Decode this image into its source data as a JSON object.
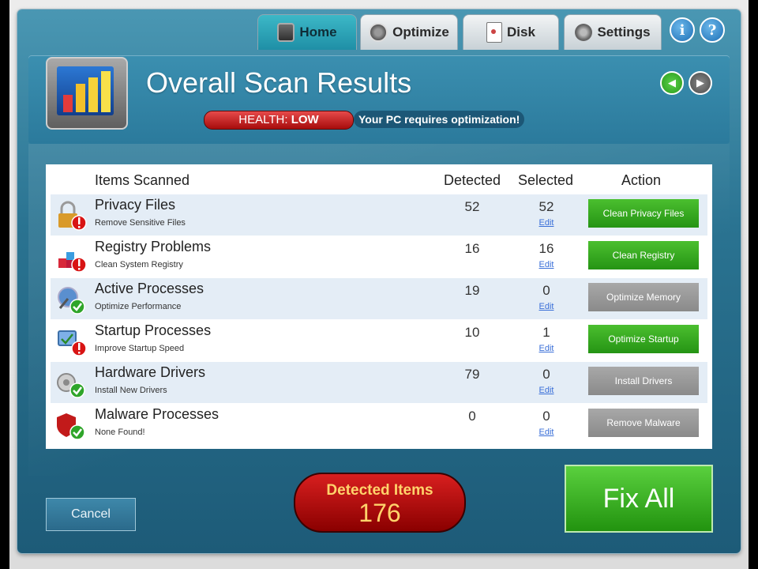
{
  "tabs": [
    {
      "label": "Home",
      "icon": "home-icon",
      "active": true
    },
    {
      "label": "Optimize",
      "icon": "optimize-icon",
      "active": false
    },
    {
      "label": "Disk",
      "icon": "disk-icon",
      "active": false
    },
    {
      "label": "Settings",
      "icon": "settings-icon",
      "active": false
    }
  ],
  "header": {
    "title": "Overall Scan Results",
    "health_prefix": "HEALTH:",
    "health_value": "LOW",
    "message": "Your PC requires optimization!"
  },
  "round_buttons": {
    "info": "i",
    "help": "?"
  },
  "table": {
    "columns": {
      "items": "Items Scanned",
      "detected": "Detected",
      "selected": "Selected",
      "action": "Action"
    },
    "rows": [
      {
        "title": "Privacy Files",
        "subtitle": "Remove Sensitive Files",
        "detected": "52",
        "selected": "52",
        "edit": "Edit",
        "action": "Clean Privacy Files",
        "action_enabled": true,
        "icon": "lock-warning-icon"
      },
      {
        "title": "Registry Problems",
        "subtitle": "Clean System Registry",
        "detected": "16",
        "selected": "16",
        "edit": "Edit",
        "action": "Clean Registry",
        "action_enabled": true,
        "icon": "registry-warning-icon"
      },
      {
        "title": "Active Processes",
        "subtitle": "Optimize Performance",
        "detected": "19",
        "selected": "0",
        "edit": "Edit",
        "action": "Optimize Memory",
        "action_enabled": false,
        "icon": "process-check-icon"
      },
      {
        "title": "Startup Processes",
        "subtitle": "Improve Startup Speed",
        "detected": "10",
        "selected": "1",
        "edit": "Edit",
        "action": "Optimize Startup",
        "action_enabled": true,
        "icon": "startup-warning-icon"
      },
      {
        "title": "Hardware Drivers",
        "subtitle": "Install New Drivers",
        "detected": "79",
        "selected": "0",
        "edit": "Edit",
        "action": "Install Drivers",
        "action_enabled": false,
        "icon": "drivers-check-icon"
      },
      {
        "title": "Malware Processes",
        "subtitle": "None Found!",
        "detected": "0",
        "selected": "0",
        "edit": "Edit",
        "action": "Remove Malware",
        "action_enabled": false,
        "icon": "malware-check-icon"
      }
    ]
  },
  "footer": {
    "cancel": "Cancel",
    "detected_label": "Detected Items",
    "detected_count": "176",
    "fix_all": "Fix All"
  },
  "colors": {
    "accent_green": "#2ea81b",
    "health_red": "#c81414",
    "panel_blue": "#2b7a9c"
  }
}
